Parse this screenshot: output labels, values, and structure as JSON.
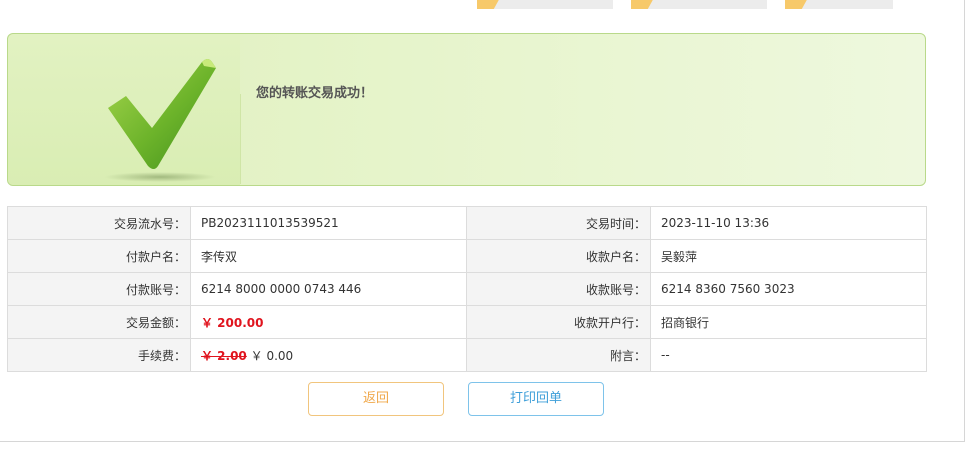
{
  "banner": {
    "message": "您的转账交易成功！",
    "colors": {
      "check": "#6cb32a",
      "check_light": "#9fd24a"
    }
  },
  "details": {
    "serial": {
      "label": "交易流水号：",
      "value": "PB2023111013539521"
    },
    "time": {
      "label": "交易时间：",
      "value": "2023-11-10 13:36"
    },
    "payer_name": {
      "label": "付款户名：",
      "value": "李传双"
    },
    "payee_name": {
      "label": "收款户名：",
      "value": "吴毅萍"
    },
    "payer_account": {
      "label": "付款账号：",
      "value": "6214 8000 0000 0743 446"
    },
    "payee_account": {
      "label": "收款账号：",
      "value": "6214 8360 7560 3023"
    },
    "amount": {
      "label": "交易金额：",
      "value": "￥ 200.00"
    },
    "payee_bank": {
      "label": "收款开户行：",
      "value": "招商银行"
    },
    "fee": {
      "label": "手续费：",
      "original": "￥ 2.00",
      "actual": "￥ 0.00"
    },
    "note": {
      "label": "附言：",
      "value": "--"
    }
  },
  "buttons": {
    "back": "返回",
    "print": "打印回单"
  }
}
